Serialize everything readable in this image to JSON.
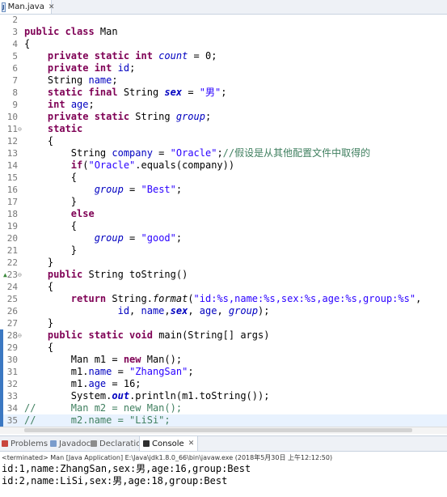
{
  "editor": {
    "tab_label": "Man.java",
    "tab_close": "✕"
  },
  "code_lines": [
    {
      "n": "2",
      "t": []
    },
    {
      "n": "3",
      "t": [
        {
          "c": "kw",
          "v": "public class "
        },
        {
          "c": "",
          "v": "Man"
        }
      ]
    },
    {
      "n": "4",
      "t": [
        {
          "c": "",
          "v": "{"
        }
      ]
    },
    {
      "n": "5",
      "t": [
        {
          "c": "",
          "v": "    "
        },
        {
          "c": "kw",
          "v": "private static int "
        },
        {
          "c": "sfld",
          "v": "count"
        },
        {
          "c": "",
          "v": " = 0;"
        }
      ]
    },
    {
      "n": "6",
      "t": [
        {
          "c": "",
          "v": "    "
        },
        {
          "c": "kw",
          "v": "private int "
        },
        {
          "c": "fld",
          "v": "id"
        },
        {
          "c": "",
          "v": ";"
        }
      ]
    },
    {
      "n": "7",
      "t": [
        {
          "c": "",
          "v": "    String "
        },
        {
          "c": "fld",
          "v": "name"
        },
        {
          "c": "",
          "v": ";"
        }
      ]
    },
    {
      "n": "8",
      "t": [
        {
          "c": "",
          "v": "    "
        },
        {
          "c": "kw",
          "v": "static final "
        },
        {
          "c": "",
          "v": "String "
        },
        {
          "c": "sfb",
          "v": "sex"
        },
        {
          "c": "",
          "v": " = "
        },
        {
          "c": "str",
          "v": "\"男\""
        },
        {
          "c": "",
          "v": ";"
        }
      ]
    },
    {
      "n": "9",
      "t": [
        {
          "c": "",
          "v": "    "
        },
        {
          "c": "kw",
          "v": "int "
        },
        {
          "c": "fld",
          "v": "age"
        },
        {
          "c": "",
          "v": ";"
        }
      ]
    },
    {
      "n": "10",
      "t": [
        {
          "c": "",
          "v": "    "
        },
        {
          "c": "kw",
          "v": "private static "
        },
        {
          "c": "",
          "v": "String "
        },
        {
          "c": "sfld",
          "v": "group"
        },
        {
          "c": "",
          "v": ";"
        }
      ]
    },
    {
      "n": "11",
      "t": [
        {
          "c": "",
          "v": "    "
        },
        {
          "c": "kw",
          "v": "static"
        }
      ],
      "fold": true
    },
    {
      "n": "12",
      "t": [
        {
          "c": "",
          "v": "    {"
        }
      ]
    },
    {
      "n": "13",
      "t": [
        {
          "c": "",
          "v": "        String "
        },
        {
          "c": "fld",
          "v": "company"
        },
        {
          "c": "",
          "v": " = "
        },
        {
          "c": "str",
          "v": "\"Oracle\""
        },
        {
          "c": "",
          "v": ";"
        },
        {
          "c": "cmt",
          "v": "//假设是从其他配置文件中取得的"
        }
      ]
    },
    {
      "n": "14",
      "t": [
        {
          "c": "",
          "v": "        "
        },
        {
          "c": "kw",
          "v": "if"
        },
        {
          "c": "",
          "v": "("
        },
        {
          "c": "str",
          "v": "\"Oracle\""
        },
        {
          "c": "",
          "v": ".equals(company))"
        }
      ]
    },
    {
      "n": "15",
      "t": [
        {
          "c": "",
          "v": "        {"
        }
      ]
    },
    {
      "n": "16",
      "t": [
        {
          "c": "",
          "v": "            "
        },
        {
          "c": "sfld",
          "v": "group"
        },
        {
          "c": "",
          "v": " = "
        },
        {
          "c": "str",
          "v": "\"Best\""
        },
        {
          "c": "",
          "v": ";"
        }
      ]
    },
    {
      "n": "17",
      "t": [
        {
          "c": "",
          "v": "        }"
        }
      ]
    },
    {
      "n": "18",
      "t": [
        {
          "c": "",
          "v": "        "
        },
        {
          "c": "kw",
          "v": "else"
        }
      ]
    },
    {
      "n": "19",
      "t": [
        {
          "c": "",
          "v": "        {"
        }
      ]
    },
    {
      "n": "20",
      "t": [
        {
          "c": "",
          "v": "            "
        },
        {
          "c": "sfld",
          "v": "group"
        },
        {
          "c": "",
          "v": " = "
        },
        {
          "c": "str",
          "v": "\"good\""
        },
        {
          "c": "",
          "v": ";"
        }
      ]
    },
    {
      "n": "21",
      "t": [
        {
          "c": "",
          "v": "        }"
        }
      ]
    },
    {
      "n": "22",
      "t": [
        {
          "c": "",
          "v": "    }"
        }
      ]
    },
    {
      "n": "23",
      "t": [
        {
          "c": "",
          "v": "    "
        },
        {
          "c": "kw",
          "v": "public "
        },
        {
          "c": "",
          "v": "String toString()"
        }
      ],
      "fold": true,
      "override": true
    },
    {
      "n": "24",
      "t": [
        {
          "c": "",
          "v": "    {"
        }
      ]
    },
    {
      "n": "25",
      "t": [
        {
          "c": "",
          "v": "        "
        },
        {
          "c": "kw",
          "v": "return "
        },
        {
          "c": "",
          "v": "String."
        },
        {
          "c": "it",
          "v": "format"
        },
        {
          "c": "",
          "v": "("
        },
        {
          "c": "str",
          "v": "\"id:%s,name:%s,sex:%s,age:%s,group:%s\""
        },
        {
          "c": "",
          "v": ","
        }
      ]
    },
    {
      "n": "26",
      "t": [
        {
          "c": "",
          "v": "                "
        },
        {
          "c": "fld",
          "v": "id"
        },
        {
          "c": "",
          "v": ", "
        },
        {
          "c": "fld",
          "v": "name"
        },
        {
          "c": "",
          "v": ","
        },
        {
          "c": "sfb",
          "v": "sex"
        },
        {
          "c": "",
          "v": ", "
        },
        {
          "c": "fld",
          "v": "age"
        },
        {
          "c": "",
          "v": ", "
        },
        {
          "c": "sfld",
          "v": "group"
        },
        {
          "c": "",
          "v": ");"
        }
      ]
    },
    {
      "n": "27",
      "t": [
        {
          "c": "",
          "v": "    }"
        }
      ]
    },
    {
      "n": "28",
      "t": [
        {
          "c": "",
          "v": "    "
        },
        {
          "c": "kw",
          "v": "public static void "
        },
        {
          "c": "",
          "v": "main(String[] args)"
        }
      ],
      "fold": true,
      "ruler": true
    },
    {
      "n": "29",
      "t": [
        {
          "c": "",
          "v": "    {"
        }
      ],
      "ruler": true
    },
    {
      "n": "30",
      "t": [
        {
          "c": "",
          "v": "        Man m1 = "
        },
        {
          "c": "kw",
          "v": "new "
        },
        {
          "c": "",
          "v": "Man();"
        }
      ],
      "ruler": true
    },
    {
      "n": "31",
      "t": [
        {
          "c": "",
          "v": "        m1."
        },
        {
          "c": "fld",
          "v": "name"
        },
        {
          "c": "",
          "v": " = "
        },
        {
          "c": "str",
          "v": "\"ZhangSan\""
        },
        {
          "c": "",
          "v": ";"
        }
      ],
      "ruler": true
    },
    {
      "n": "32",
      "t": [
        {
          "c": "",
          "v": "        m1."
        },
        {
          "c": "fld",
          "v": "age"
        },
        {
          "c": "",
          "v": " = 16;"
        }
      ],
      "ruler": true
    },
    {
      "n": "33",
      "t": [
        {
          "c": "",
          "v": "        System."
        },
        {
          "c": "bi",
          "v": "out"
        },
        {
          "c": "",
          "v": ".println(m1.toString());"
        }
      ],
      "ruler": true
    },
    {
      "n": "34",
      "t": [
        {
          "c": "cmt",
          "v": "//      Man m2 = new Man();"
        }
      ],
      "ruler": true
    },
    {
      "n": "35",
      "t": [
        {
          "c": "cmt",
          "v": "//      m2.name = \"LiSi\";"
        }
      ],
      "ruler": true,
      "hl": true
    }
  ],
  "bottom_tabs": {
    "problems": "Problems",
    "javadoc": "Javadoc",
    "declaration": "Declaration",
    "console": "Console",
    "console_close": "✕"
  },
  "console": {
    "status": "<terminated> Man [Java Application] E:\\Java\\jdk1.8.0_66\\bin\\javaw.exe (2018年5月30日 上午12:12:50)",
    "lines": [
      "id:1,name:ZhangSan,sex:男,age:16,group:Best",
      "id:2,name:LiSi,sex:男,age:18,group:Best"
    ]
  },
  "colors": {
    "keyword": "#7f0055",
    "field": "#0000c0",
    "string": "#2a00ff",
    "comment": "#3f7f5f"
  }
}
